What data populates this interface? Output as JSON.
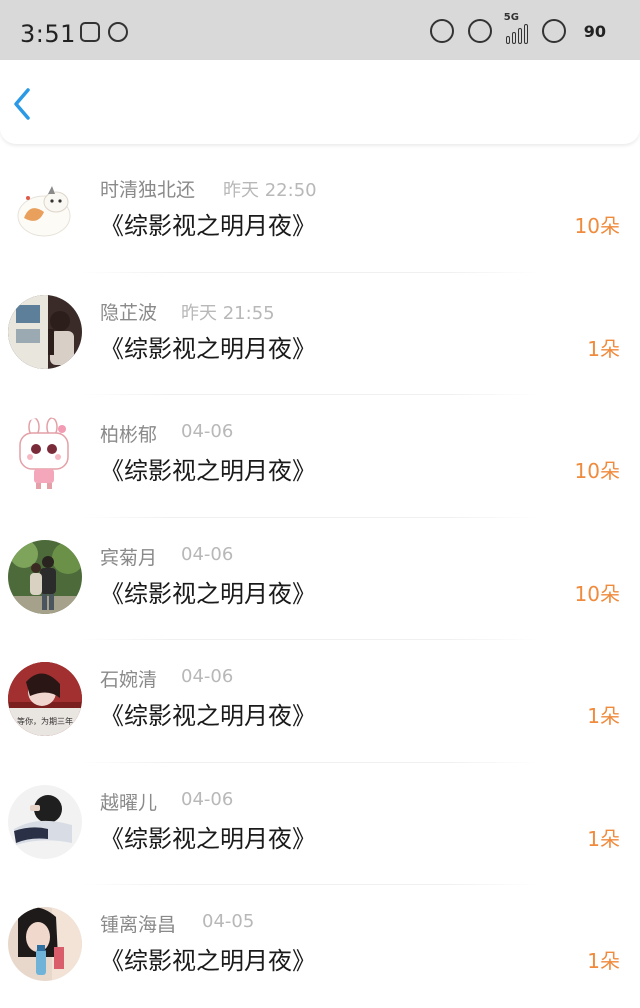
{
  "status_bar": {
    "time": "3:51",
    "signal_tag": "5G",
    "battery": "90"
  },
  "colors": {
    "accent_blue": "#2a9ae6",
    "count_orange": "#f08a3c"
  },
  "items": [
    {
      "name": "时清独北还",
      "time": "昨天 22:50",
      "title": "《综影视之明月夜》",
      "count": "10朵",
      "avatar": "cat-sticker"
    },
    {
      "name": "隐芷波",
      "time": "昨天 21:55",
      "title": "《综影视之明月夜》",
      "count": "1朵",
      "avatar": "girl-photo"
    },
    {
      "name": "柏彬郁",
      "time": "04-06",
      "title": "《综影视之明月夜》",
      "count": "10朵",
      "avatar": "bunny-cartoon"
    },
    {
      "name": "宾菊月",
      "time": "04-06",
      "title": "《综影视之明月夜》",
      "count": "10朵",
      "avatar": "couple-photo"
    },
    {
      "name": "石婉清",
      "time": "04-06",
      "title": "《综影视之明月夜》",
      "count": "1朵",
      "avatar": "text-photo"
    },
    {
      "name": "越曜儿",
      "time": "04-06",
      "title": "《综影视之明月夜》",
      "count": "1朵",
      "avatar": "sleeping-photo"
    },
    {
      "name": "锺离海昌",
      "time": "04-05",
      "title": "《综影视之明月夜》",
      "count": "1朵",
      "avatar": "girl-drink-photo"
    }
  ],
  "avatar_text": {
    "text_photo": "等你，为期三年"
  }
}
